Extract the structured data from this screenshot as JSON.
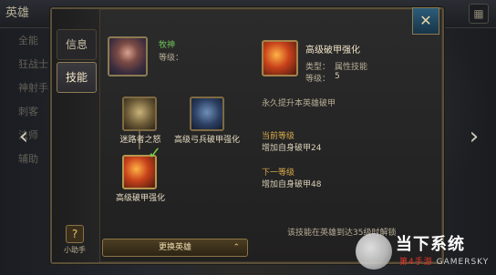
{
  "header": {
    "title": "英雄",
    "icon": "grid-icon"
  },
  "background_list": [
    "全能",
    "狂战士",
    "神射手",
    "刺客",
    "法师",
    "辅助"
  ],
  "tabs": [
    {
      "label": "信息",
      "active": false
    },
    {
      "label": "技能",
      "active": true
    }
  ],
  "help": {
    "label": "小助手"
  },
  "hero": {
    "name": "牧神",
    "level_label": "等级：",
    "level_value": ""
  },
  "skills": [
    {
      "label": "迷路者之怒"
    },
    {
      "label": "高级弓兵破甲强化"
    },
    {
      "label": "高级破甲强化",
      "selected": true
    }
  ],
  "change_hero": {
    "label": "更换英雄"
  },
  "detail": {
    "title": "高级破甲强化",
    "type_label": "类型：",
    "type_value": "属性技能",
    "level_label": "等级：",
    "level_value": "5",
    "description": "永久提升本英雄破甲",
    "current_header": "当前等级",
    "current_value": "增加自身破甲24",
    "next_header": "下一等级",
    "next_value": "增加自身破甲48",
    "unlock": "该技能在英雄到达35级时解锁"
  },
  "watermark": {
    "main_a": "当下系统",
    "main_b": "第4手游",
    "sub": "GAMERSKY"
  },
  "colors": {
    "accent_gold": "#8c7a52",
    "highlight_green": "#6fc35a",
    "section_orange": "#d6a94a"
  }
}
